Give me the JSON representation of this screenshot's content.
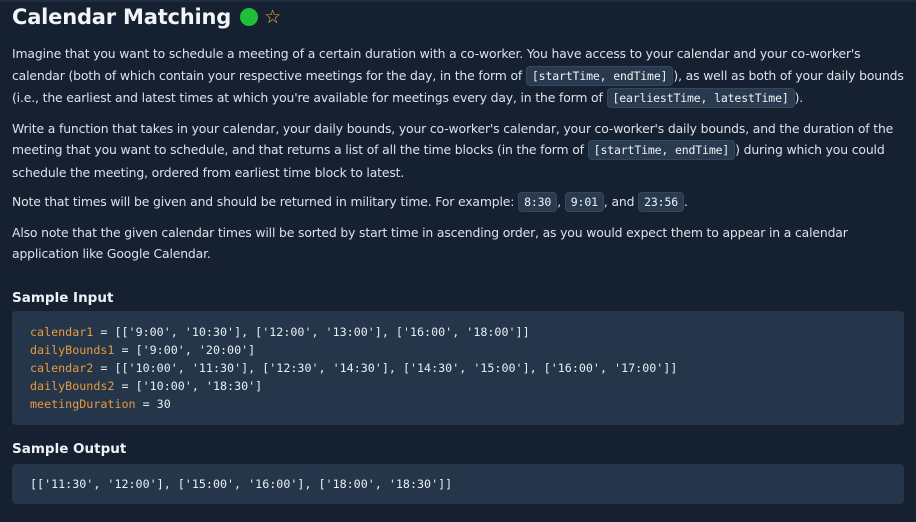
{
  "header": {
    "title": "Calendar Matching",
    "status_color": "#1fbf3a",
    "star_icon": "☆"
  },
  "description": {
    "p1_a": "Imagine that you want to schedule a meeting of a certain duration with a co-worker. You have access to your calendar and your co-worker's calendar (both of which contain your respective meetings for the day, in the form of ",
    "p1_code1": "[startTime, endTime]",
    "p1_b": "), as well as both of your daily bounds (i.e., the earliest and latest times at which you're available for meetings every day, in the form of ",
    "p1_code2": "[earliestTime, latestTime]",
    "p1_c": ").",
    "p2_a": "Write a function that takes in your calendar, your daily bounds, your co-worker's calendar, your co-worker's daily bounds, and the duration of the meeting that you want to schedule, and that returns a list of all the time blocks (in the form of ",
    "p2_code": "[startTime, endTime]",
    "p2_b": ") during which you could schedule the meeting, ordered from earliest time block to latest.",
    "p3_a": "Note that times will be given and should be returned in military time. For example: ",
    "p3_code1": "8:30",
    "p3_sep1": ", ",
    "p3_code2": "9:01",
    "p3_sep2": ", and ",
    "p3_code3": "23:56",
    "p3_end": ".",
    "p4": "Also note that the given calendar times will be sorted by start time in ascending order, as you would expect them to appear in a calendar application like Google Calendar."
  },
  "sample_input": {
    "heading": "Sample Input",
    "lines": [
      {
        "name": "calendar1",
        "rest": " = [['9:00', '10:30'], ['12:00', '13:00'], ['16:00', '18:00']]"
      },
      {
        "name": "dailyBounds1",
        "rest": " = ['9:00', '20:00']"
      },
      {
        "name": "calendar2",
        "rest": " = [['10:00', '11:30'], ['12:30', '14:30'], ['14:30', '15:00'], ['16:00', '17:00']]"
      },
      {
        "name": "dailyBounds2",
        "rest": " = ['10:00', '18:30']"
      },
      {
        "name": "meetingDuration",
        "rest": " = 30"
      }
    ]
  },
  "sample_output": {
    "heading": "Sample Output",
    "text": "[['11:30', '12:00'], ['15:00', '16:00'], ['18:00', '18:30']]"
  }
}
